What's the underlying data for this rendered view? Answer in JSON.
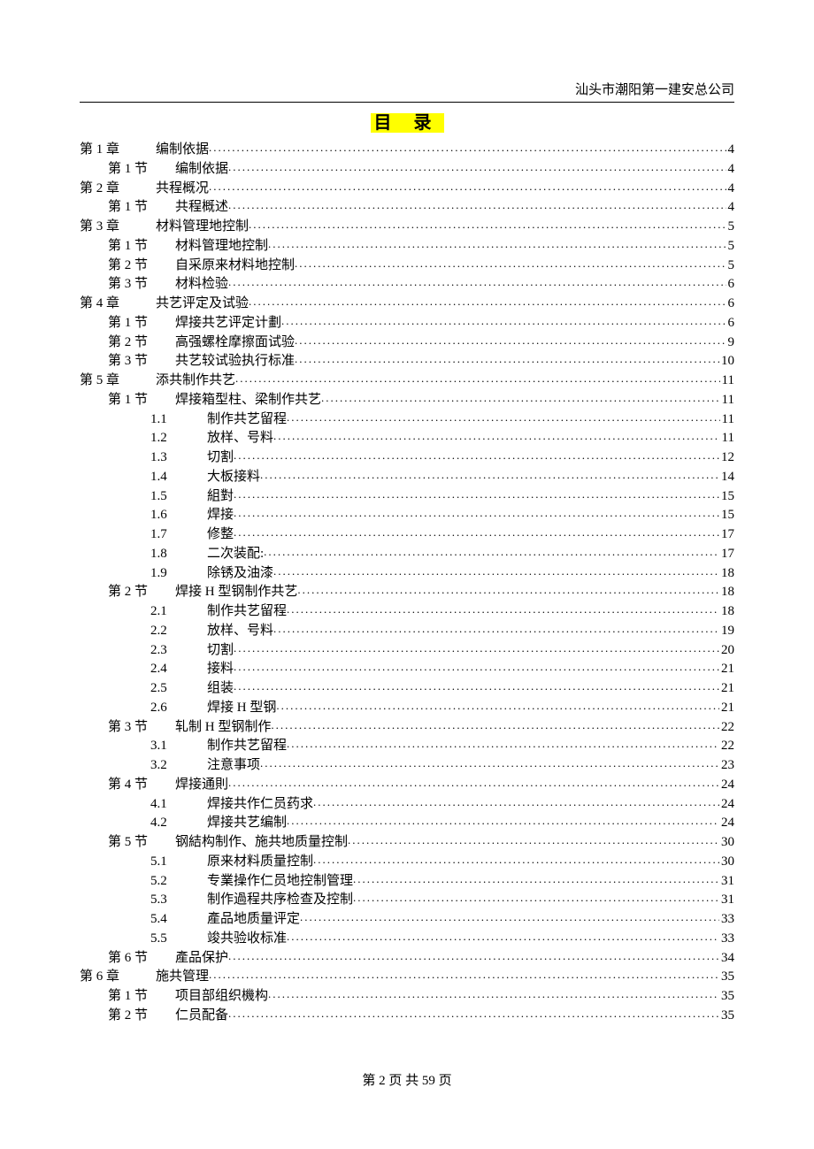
{
  "header": {
    "company": "汕头市潮阳第一建安总公司"
  },
  "title": "目 录",
  "toc": [
    {
      "level": 0,
      "label": "第 1 章",
      "title": "编制依据",
      "page": "4"
    },
    {
      "level": 1,
      "label": "第 1 节",
      "title": "编制依据",
      "page": "4"
    },
    {
      "level": 0,
      "label": "第 2 章",
      "title": "共程概况",
      "page": "4"
    },
    {
      "level": 1,
      "label": "第 1 节",
      "title": "共程概述",
      "page": "4"
    },
    {
      "level": 0,
      "label": "第 3 章",
      "title": "材料管理地控制",
      "page": "5"
    },
    {
      "level": 1,
      "label": "第 1 节",
      "title": "材料管理地控制",
      "page": "5"
    },
    {
      "level": 1,
      "label": "第 2 节",
      "title": "自采原来材料地控制",
      "page": "5"
    },
    {
      "level": 1,
      "label": "第 3 节",
      "title": "材料检验",
      "page": "6"
    },
    {
      "level": 0,
      "label": "第 4 章",
      "title": "共艺评定及试验",
      "page": "6"
    },
    {
      "level": 1,
      "label": "第 1 节",
      "title": "焊接共艺评定计劃",
      "page": "6"
    },
    {
      "level": 1,
      "label": "第 2 节",
      "title": "高强螺栓摩擦面试验",
      "page": "9"
    },
    {
      "level": 1,
      "label": "第 3 节",
      "title": "共艺较试验执行标准",
      "page": "10"
    },
    {
      "level": 0,
      "label": "第 5 章",
      "title": "添共制作共艺",
      "page": "11"
    },
    {
      "level": 1,
      "label": "第 1 节",
      "title": "焊接箱型柱、梁制作共艺",
      "page": "11"
    },
    {
      "level": 2,
      "label": "1.1",
      "title": "制作共艺留程",
      "page": "11"
    },
    {
      "level": 2,
      "label": "1.2",
      "title": "放样、号料",
      "page": "11"
    },
    {
      "level": 2,
      "label": "1.3",
      "title": "切割",
      "page": "12"
    },
    {
      "level": 2,
      "label": "1.4",
      "title": "大板接料",
      "page": "14"
    },
    {
      "level": 2,
      "label": "1.5",
      "title": "組對",
      "page": "15"
    },
    {
      "level": 2,
      "label": "1.6",
      "title": "焊接",
      "page": "15"
    },
    {
      "level": 2,
      "label": "1.7",
      "title": "修整",
      "page": "17"
    },
    {
      "level": 2,
      "label": "1.8",
      "title": "二次装配:",
      "page": "17"
    },
    {
      "level": 2,
      "label": "1.9",
      "title": "除锈及油漆",
      "page": "18"
    },
    {
      "level": 1,
      "label": "第 2 节",
      "title": "焊接 H 型钢制作共艺",
      "page": "18"
    },
    {
      "level": 2,
      "label": "2.1",
      "title": "制作共艺留程",
      "page": "18"
    },
    {
      "level": 2,
      "label": "2.2",
      "title": "放样、号料",
      "page": "19"
    },
    {
      "level": 2,
      "label": "2.3",
      "title": "切割",
      "page": "20"
    },
    {
      "level": 2,
      "label": "2.4",
      "title": "接料",
      "page": "21"
    },
    {
      "level": 2,
      "label": "2.5",
      "title": "组装",
      "page": "21"
    },
    {
      "level": 2,
      "label": "2.6",
      "title": "焊接 H 型钢",
      "page": "21"
    },
    {
      "level": 1,
      "label": "第 3 节",
      "title": "轧制 H 型钢制作",
      "page": "22"
    },
    {
      "level": 2,
      "label": "3.1",
      "title": "制作共艺留程",
      "page": "22"
    },
    {
      "level": 2,
      "label": "3.2",
      "title": "注意事项",
      "page": "23"
    },
    {
      "level": 1,
      "label": "第 4 节",
      "title": "焊接通則",
      "page": "24"
    },
    {
      "level": 2,
      "label": "4.1",
      "title": "焊接共作仁员药求",
      "page": "24"
    },
    {
      "level": 2,
      "label": "4.2",
      "title": "焊接共艺编制",
      "page": "24"
    },
    {
      "level": 1,
      "label": "第 5 节",
      "title": "钢結构制作、施共地质量控制",
      "page": "30"
    },
    {
      "level": 2,
      "label": "5.1",
      "title": "原来材料质量控制",
      "page": "30"
    },
    {
      "level": 2,
      "label": "5.2",
      "title": "专業操作仁员地控制管理",
      "page": "31"
    },
    {
      "level": 2,
      "label": "5.3",
      "title": "制作過程共序检查及控制",
      "page": "31"
    },
    {
      "level": 2,
      "label": "5.4",
      "title": "產品地质量评定",
      "page": "33"
    },
    {
      "level": 2,
      "label": "5.5",
      "title": "竣共验收标准",
      "page": "33"
    },
    {
      "level": 1,
      "label": "第 6 节",
      "title": "產品保护",
      "page": "34"
    },
    {
      "level": 0,
      "label": "第 6 章",
      "title": "施共管理",
      "page": "35"
    },
    {
      "level": 1,
      "label": "第 1 节",
      "title": "项目部组织機构",
      "page": "35"
    },
    {
      "level": 1,
      "label": "第 2 节",
      "title": "仁员配备",
      "page": "35"
    }
  ],
  "footer": {
    "pager": "第 2 页 共 59 页"
  }
}
